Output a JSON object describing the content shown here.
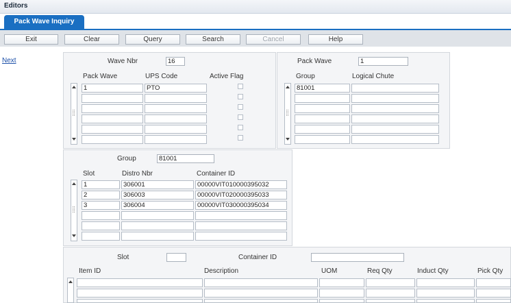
{
  "header": {
    "title": "Editors"
  },
  "tab": {
    "label": "Pack Wave Inquiry"
  },
  "toolbar": {
    "exit": "Exit",
    "clear": "Clear",
    "query": "Query",
    "search": "Search",
    "cancel": "Cancel",
    "help": "Help"
  },
  "side": {
    "next": "Next"
  },
  "wave_panel": {
    "wave_nbr_label": "Wave Nbr",
    "wave_nbr": "16",
    "col_pack_wave": "Pack Wave",
    "col_ups_code": "UPS Code",
    "col_active_flag": "Active Flag",
    "rows": [
      {
        "pack_wave": "1",
        "ups_code": "PTO"
      }
    ]
  },
  "group_panel": {
    "pack_wave_label": "Pack Wave",
    "pack_wave": "1",
    "col_group": "Group",
    "col_logical_chute": "Logical Chute",
    "rows": [
      {
        "group": "81001",
        "logical_chute": ""
      }
    ]
  },
  "slot_panel": {
    "group_label": "Group",
    "group": "81001",
    "col_slot": "Slot",
    "col_distro_nbr": "Distro Nbr",
    "col_container_id": "Container ID",
    "rows": [
      {
        "slot": "1",
        "distro_nbr": "306001",
        "container_id": "00000VIT010000395032"
      },
      {
        "slot": "2",
        "distro_nbr": "306003",
        "container_id": "00000VIT020000395033"
      },
      {
        "slot": "3",
        "distro_nbr": "306004",
        "container_id": "00000VIT030000395034"
      }
    ]
  },
  "item_panel": {
    "slot_label": "Slot",
    "slot": "",
    "container_id_label": "Container ID",
    "container_id": "",
    "col_item_id": "Item ID",
    "col_description": "Description",
    "col_uom": "UOM",
    "col_req_qty": "Req Qty",
    "col_induct_qty": "Induct Qty",
    "col_pick_qty": "Pick Qty"
  }
}
